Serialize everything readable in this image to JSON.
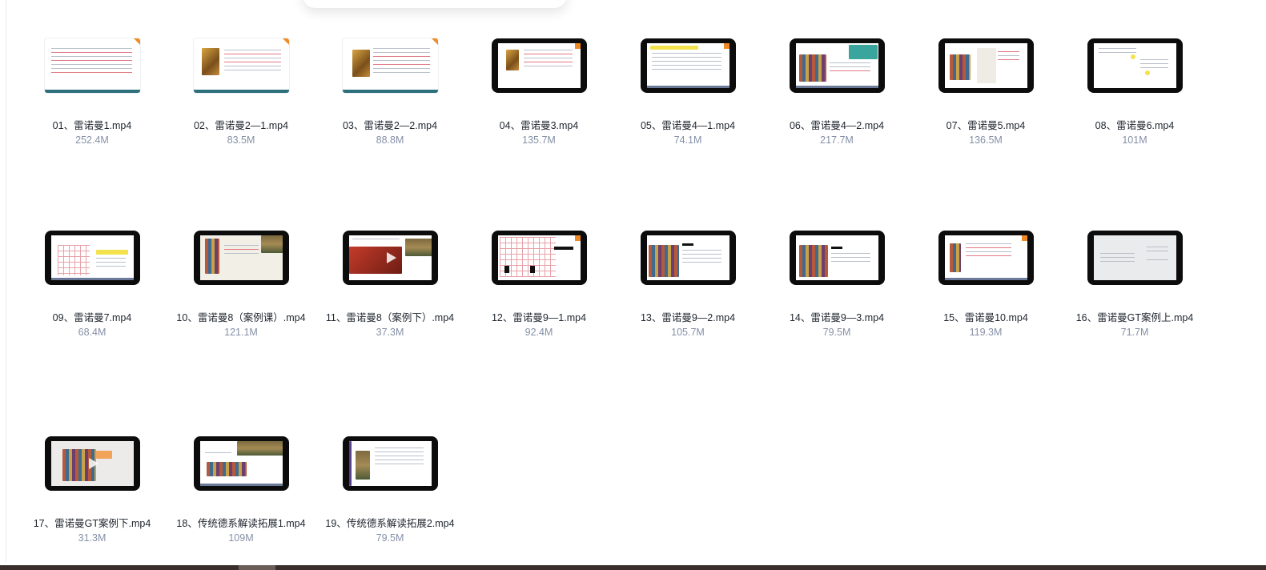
{
  "files": [
    {
      "name": "01、雷诺曼1.mp4",
      "size": "252.4M",
      "thumb": "doc-text-red-icon"
    },
    {
      "name": "02、雷诺曼2—1.mp4",
      "size": "83.5M",
      "thumb": "doc-card-text-icon"
    },
    {
      "name": "03、雷诺曼2—2.mp4",
      "size": "88.8M",
      "thumb": "doc-card-text-icon"
    },
    {
      "name": "04、雷诺曼3.mp4",
      "size": "135.7M",
      "thumb": "video-slide-card-icon"
    },
    {
      "name": "05、雷诺曼4—1.mp4",
      "size": "74.1M",
      "thumb": "video-slide-text-icon"
    },
    {
      "name": "06、雷诺曼4—2.mp4",
      "size": "217.7M",
      "thumb": "video-slide-case-icon"
    },
    {
      "name": "07、雷诺曼5.mp4",
      "size": "136.5M",
      "thumb": "video-slide-card-icon"
    },
    {
      "name": "08、雷诺曼6.mp4",
      "size": "101M",
      "thumb": "video-slide-diagram-icon"
    },
    {
      "name": "09、雷诺曼7.mp4",
      "size": "68.4M",
      "thumb": "video-slide-grid-icon"
    },
    {
      "name": "10、雷诺曼8（案例课）.mp4",
      "size": "121.1M",
      "thumb": "video-slide-scenic-icon"
    },
    {
      "name": "11、雷诺曼8（案例下）.mp4",
      "size": "37.3M",
      "thumb": "video-slide-play-icon"
    },
    {
      "name": "12、雷诺曼9—1.mp4",
      "size": "92.4M",
      "thumb": "video-slide-table-icon"
    },
    {
      "name": "13、雷诺曼9—2.mp4",
      "size": "105.7M",
      "thumb": "video-slide-cards-icon"
    },
    {
      "name": "14、雷诺曼9—3.mp4",
      "size": "79.5M",
      "thumb": "video-slide-cards-icon"
    },
    {
      "name": "15、雷诺曼10.mp4",
      "size": "119.3M",
      "thumb": "video-slide-card-icon"
    },
    {
      "name": "16、雷诺曼GT案例上.mp4",
      "size": "71.7M",
      "thumb": "video-slide-pale-icon"
    },
    {
      "name": "17、雷诺曼GT案例下.mp4",
      "size": "31.3M",
      "thumb": "video-slide-play-icon"
    },
    {
      "name": "18、传统德系解读拓展1.mp4",
      "size": "109M",
      "thumb": "video-slide-scenic-icon"
    },
    {
      "name": "19、传统德系解读拓展2.mp4",
      "size": "79.5M",
      "thumb": "video-slide-card-icon"
    }
  ]
}
